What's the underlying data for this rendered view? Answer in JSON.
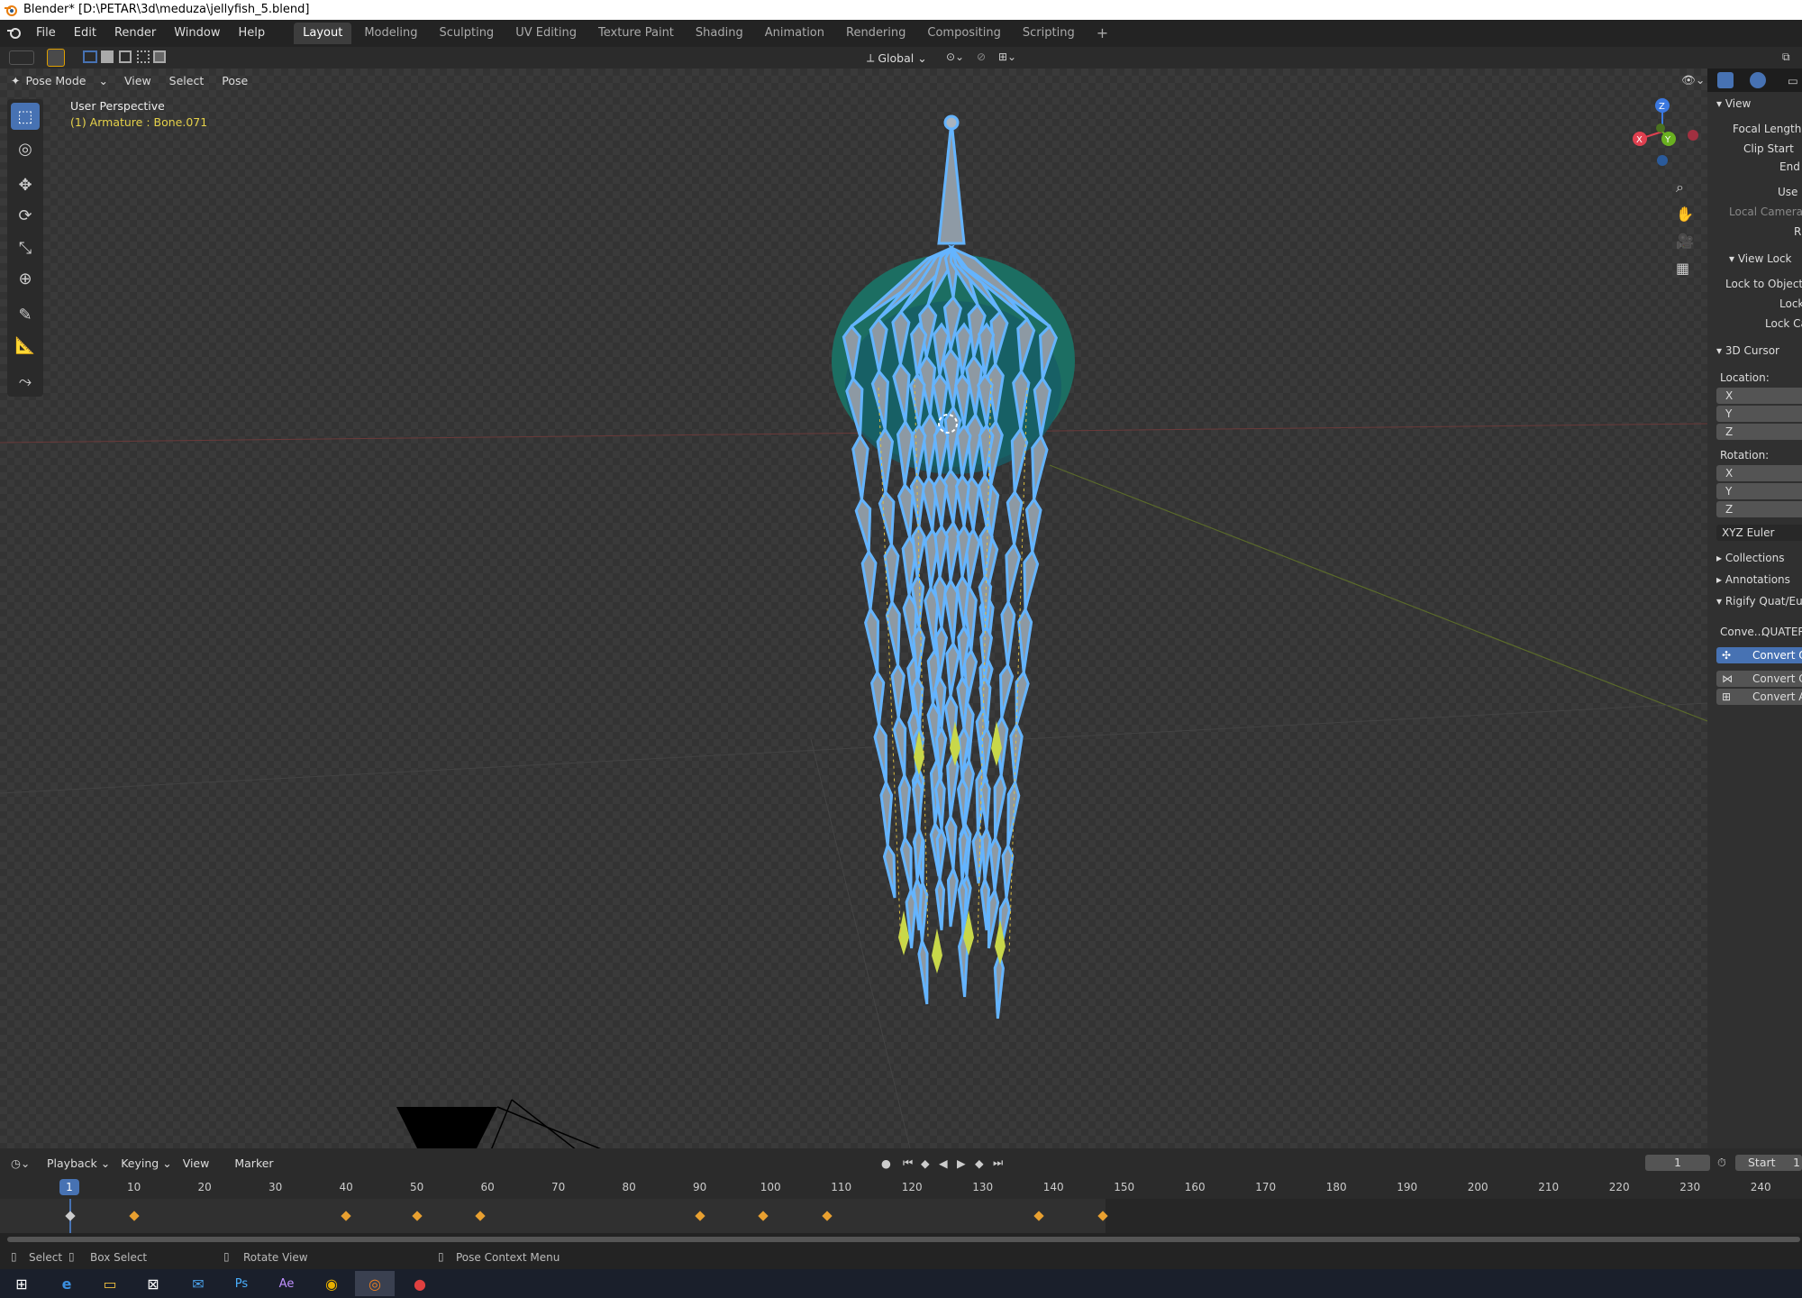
{
  "window": {
    "title": "Blender* [D:\\PETAR\\3d\\meduza\\jellyfish_5.blend]"
  },
  "menu": [
    "File",
    "Edit",
    "Render",
    "Window",
    "Help"
  ],
  "workspaces": [
    "Layout",
    "Modeling",
    "Sculpting",
    "UV Editing",
    "Texture Paint",
    "Shading",
    "Animation",
    "Rendering",
    "Compositing",
    "Scripting"
  ],
  "active_workspace": "Layout",
  "toolbar": {
    "orientation": "Global"
  },
  "viewport_header": {
    "mode": "Pose Mode",
    "menus": [
      "View",
      "Select",
      "Pose"
    ]
  },
  "viewport": {
    "perspective": "User Perspective",
    "active": "(1) Armature : Bone.071"
  },
  "gizmo": {
    "x": "X",
    "y": "Y",
    "z": "Z"
  },
  "npanel": {
    "view_title": "View",
    "focal_length": "Focal Length",
    "clip_start": "Clip Start",
    "end": "End",
    "use_local": "Use L",
    "local_camera": "Local Camera",
    "r": "R",
    "view_lock": "View Lock",
    "lock_to_object": "Lock to Object",
    "lock": "Lock",
    "lock_cam": "Lock Car",
    "cursor_title": "3D Cursor",
    "location": "Location:",
    "rotation": "Rotation:",
    "axes": [
      "X",
      "Y",
      "Z"
    ],
    "rot_mode": "XYZ Euler",
    "collections": "Collections",
    "annotations": "Annotations",
    "rigify": "Rigify Quat/Eul",
    "conve": "Conve...",
    "quater": "QUATER",
    "convert_btns": [
      "Convert O",
      "Convert C",
      "Convert A"
    ]
  },
  "timeline": {
    "menus": [
      "Playback",
      "Keying",
      "View",
      "Marker"
    ],
    "current_frame": "1",
    "start_label": "Start",
    "start_value": "1",
    "ticks": [
      "10",
      "20",
      "30",
      "40",
      "50",
      "60",
      "70",
      "80",
      "90",
      "100",
      "110",
      "120",
      "130",
      "140",
      "150",
      "160",
      "170",
      "180",
      "190",
      "200",
      "210",
      "220",
      "230",
      "240"
    ]
  },
  "status": {
    "select": "Select",
    "box_select": "Box Select",
    "rotate_view": "Rotate View",
    "pose_context": "Pose Context Menu"
  },
  "taskbar_icons": [
    "windows-start",
    "edge",
    "file-explorer",
    "store",
    "mail",
    "photoshop",
    "after-effects",
    "chrome",
    "blender",
    "chat"
  ]
}
